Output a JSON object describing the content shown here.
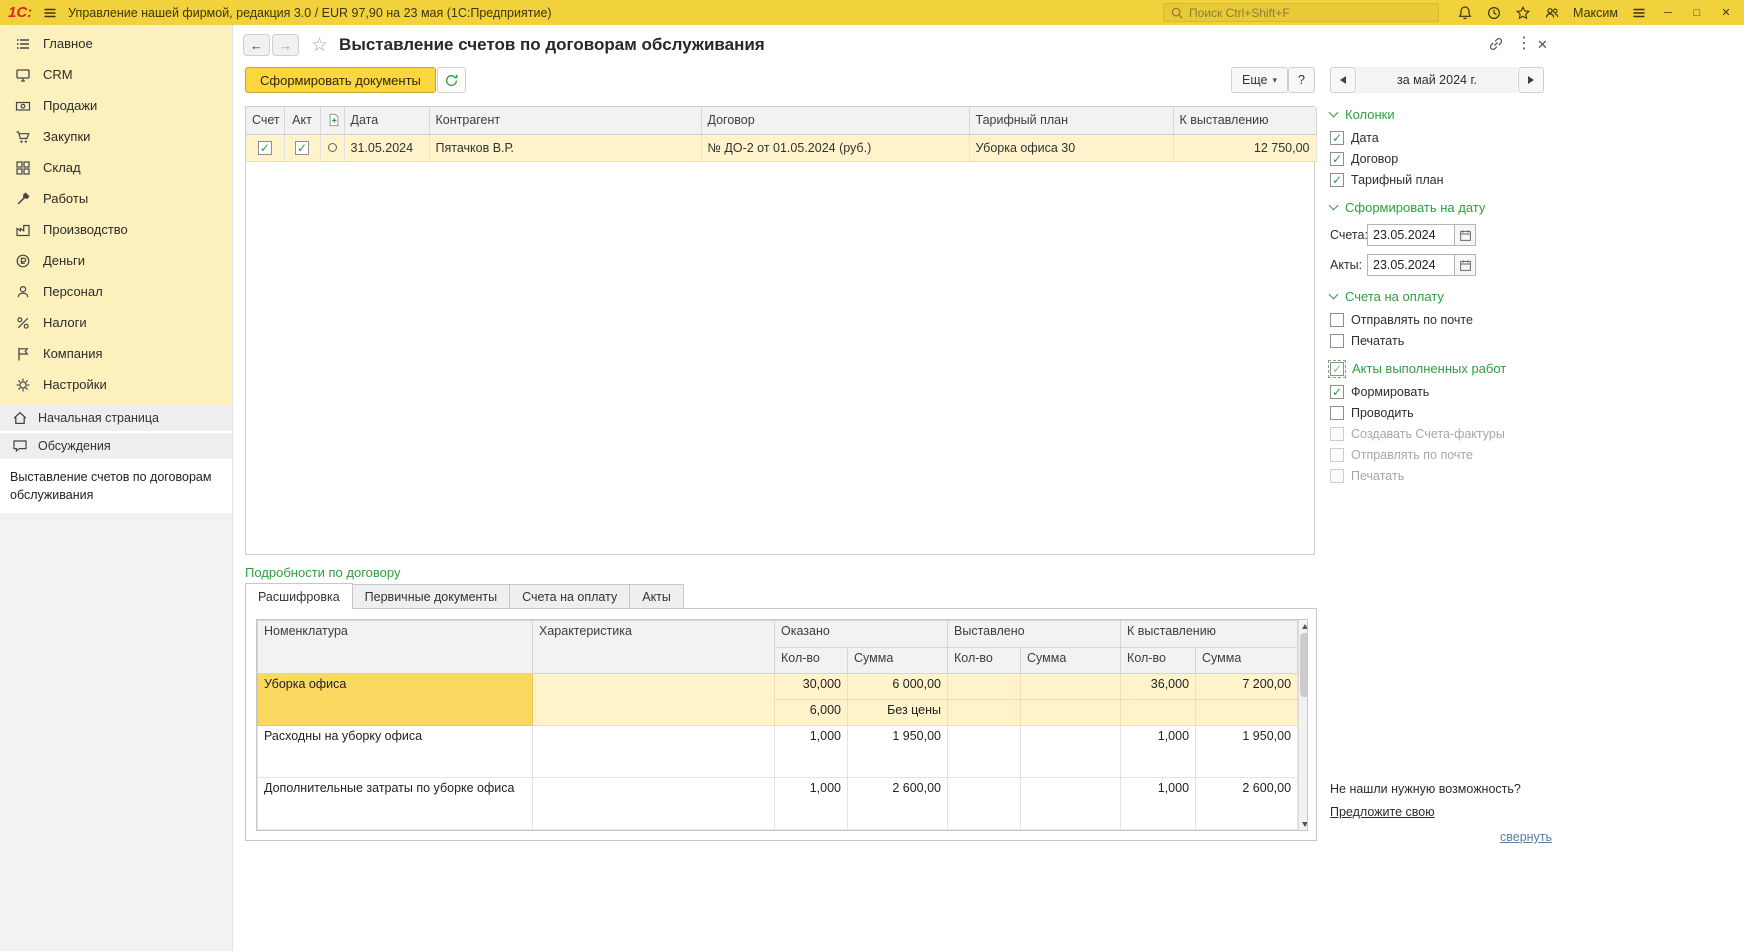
{
  "colors": {
    "topbar_yellow": "#f2d23c",
    "sidebar_yellow": "#fcf0bc",
    "accent_green": "#2f9e3f",
    "primary_button_yellow": "#fbd63e",
    "row_highlight": "#fff3cc",
    "cell_highlight": "#fbd860"
  },
  "icons": {
    "back": "←",
    "forward": "→",
    "star_outline": "☆",
    "kebab": "⋮",
    "close": "✕",
    "minimize": "─",
    "maximize": "□",
    "dropdown_arrow": "▾"
  },
  "titlebar": {
    "logo": "1С:",
    "app_title": "Управление нашей фирмой, редакция 3.0 / EUR 97,90 на 23 мая  (1С:Предприятие)",
    "search_placeholder": "Поиск Ctrl+Shift+F",
    "user_name": "Максим"
  },
  "sidebar": {
    "sections": [
      {
        "label": "Главное"
      },
      {
        "label": "CRM"
      },
      {
        "label": "Продажи"
      },
      {
        "label": "Закупки"
      },
      {
        "label": "Склад"
      },
      {
        "label": "Работы"
      },
      {
        "label": "Производство"
      },
      {
        "label": "Деньги"
      },
      {
        "label": "Персонал"
      },
      {
        "label": "Налоги"
      },
      {
        "label": "Компания"
      },
      {
        "label": "Настройки"
      }
    ],
    "footer_items": [
      {
        "label": "Начальная страница"
      },
      {
        "label": "Обсуждения"
      }
    ],
    "open_window": "Выставление счетов по договорам обслуживания"
  },
  "form": {
    "title": "Выставление счетов по договорам обслуживания",
    "generate_button": "Сформировать документы",
    "more_button": "Еще",
    "help_button": "?",
    "period": "за май 2024 г."
  },
  "invoice_table": {
    "headers": {
      "schet": "Счет",
      "akt": "Акт",
      "date": "Дата",
      "counterparty": "Контрагент",
      "contract": "Договор",
      "tariff": "Тарифный план",
      "to_bill": "К выставлению"
    },
    "rows": [
      {
        "schet_checked": true,
        "akt_checked": true,
        "date": "31.05.2024",
        "counterparty": "Пятачков В.Р.",
        "contract": "№ ДО-2 от 01.05.2024 (руб.)",
        "tariff": "Уборка офиса 30",
        "to_bill": "12 750,00"
      }
    ]
  },
  "settings_panel": {
    "columns_group": {
      "title": "Колонки",
      "items": [
        {
          "label": "Дата",
          "checked": true
        },
        {
          "label": "Договор",
          "checked": true
        },
        {
          "label": "Тарифный план",
          "checked": true
        }
      ]
    },
    "generate_date_group": {
      "title": "Сформировать на дату",
      "fields": [
        {
          "label": "Счета:",
          "value": "23.05.2024"
        },
        {
          "label": "Акты:",
          "value": "23.05.2024"
        }
      ]
    },
    "invoices_group": {
      "title": "Счета на оплату",
      "items": [
        {
          "label": "Отправлять по почте",
          "checked": false
        },
        {
          "label": "Печатать",
          "checked": false
        }
      ]
    },
    "acts_group": {
      "title": "Акты выполненных работ",
      "title_checked": true,
      "items": [
        {
          "label": "Формировать",
          "checked": true,
          "disabled": false
        },
        {
          "label": "Проводить",
          "checked": false,
          "disabled": false
        },
        {
          "label": "Создавать Счета-фактуры",
          "checked": false,
          "disabled": true
        },
        {
          "label": "Отправлять по почте",
          "checked": false,
          "disabled": true
        },
        {
          "label": "Печатать",
          "checked": false,
          "disabled": true
        }
      ]
    }
  },
  "details": {
    "section_title": "Подробности по договору",
    "tabs": [
      {
        "label": "Расшифровка",
        "active": true
      },
      {
        "label": "Первичные документы",
        "active": false
      },
      {
        "label": "Счета на оплату",
        "active": false
      },
      {
        "label": "Акты",
        "active": false
      }
    ],
    "table": {
      "col_nomenclature": "Номенклатура",
      "col_characteristic": "Характеристика",
      "col_provided": "Оказано",
      "col_billed": "Выставлено",
      "col_to_bill": "К выставлению",
      "sub_qty": "Кол-во",
      "sub_sum": "Сумма",
      "rows": [
        {
          "nomenclature": "Уборка офиса",
          "characteristic": "",
          "provided_qty": "30,000",
          "provided_sum": "6 000,00",
          "billed_qty": "",
          "billed_sum": "",
          "to_bill_qty": "36,000",
          "to_bill_sum": "7 200,00"
        },
        {
          "provided_qty": "6,000",
          "provided_sum": "Без цены",
          "billed_qty": "",
          "billed_sum": "",
          "to_bill_qty": "",
          "to_bill_sum": ""
        },
        {
          "nomenclature": "Расходны на уборку офиса",
          "characteristic": "",
          "provided_qty": "1,000",
          "provided_sum": "1 950,00",
          "billed_qty": "",
          "billed_sum": "",
          "to_bill_qty": "1,000",
          "to_bill_sum": "1 950,00"
        },
        {
          "nomenclature": "Дополнительные затраты по уборке офиса",
          "characteristic": "",
          "provided_qty": "1,000",
          "provided_sum": "2 600,00",
          "billed_qty": "",
          "billed_sum": "",
          "to_bill_qty": "1,000",
          "to_bill_sum": "2 600,00"
        }
      ]
    }
  },
  "footer": {
    "feature_question": "Не нашли нужную возможность?",
    "suggest_link": "Предложите свою",
    "collapse_link": "свернуть"
  }
}
